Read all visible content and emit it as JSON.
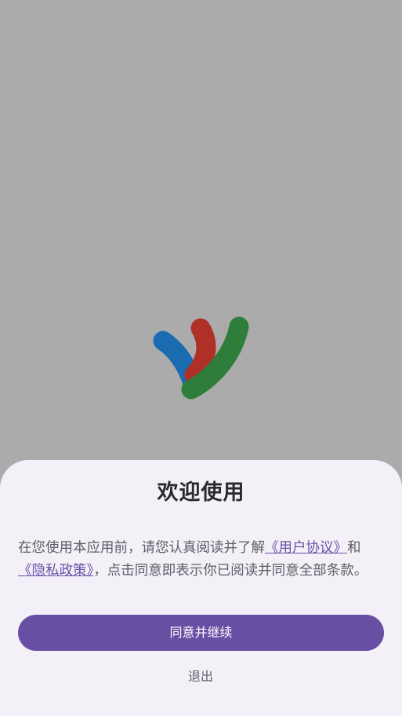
{
  "splash": {
    "logo_icon": "app-logo-icon",
    "logo_colors": {
      "blue": "#1a6bb0",
      "red": "#b03028",
      "green": "#2e7d3a"
    },
    "backdrop_color": "#ababab"
  },
  "dialog": {
    "title": "欢迎使用",
    "body_prefix": "在您使用本应用前，请您认真阅读并了解",
    "user_agreement_link": "《用户协议》",
    "conjunction": "和",
    "privacy_policy_link": "《隐私政策》",
    "body_suffix": "，点击同意即表示你已阅读并同意全部条款。",
    "agree_button": "同意并继续",
    "exit_button": "退出",
    "accent_color": "#6750a4",
    "sheet_color": "#f4f0f8"
  }
}
